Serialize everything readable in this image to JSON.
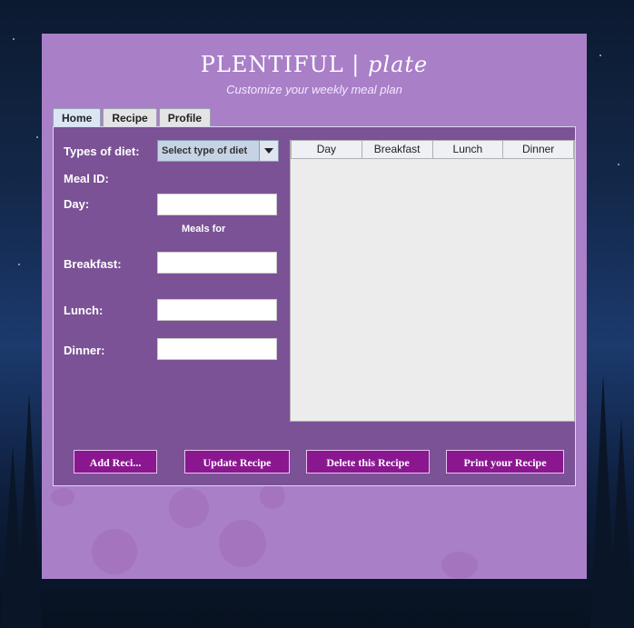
{
  "app": {
    "title_main": "PLENTIFUL |",
    "title_script": "plate",
    "subtitle": "Customize your weekly meal plan"
  },
  "tabs": [
    {
      "label": "Home",
      "active": true
    },
    {
      "label": "Recipe",
      "active": false
    },
    {
      "label": "Profile",
      "active": false
    }
  ],
  "form": {
    "diet_label": "Types of diet:",
    "diet_select": "Select type of diet",
    "meal_id_label": "Meal ID:",
    "day_label": "Day:",
    "day_value": "",
    "meals_for_label": "Meals for",
    "breakfast_label": "Breakfast:",
    "breakfast_value": "",
    "lunch_label": "Lunch:",
    "lunch_value": "",
    "dinner_label": "Dinner:",
    "dinner_value": ""
  },
  "table": {
    "columns": [
      "Day",
      "Breakfast",
      "Lunch",
      "Dinner"
    ],
    "rows": []
  },
  "buttons": {
    "add": "Add Reci...",
    "update": "Update Recipe",
    "delete": "Delete this Recipe",
    "print": "Print your Recipe"
  },
  "colors": {
    "frame_bg": "#a97fc8",
    "panel_bg": "#7b5296",
    "button_bg": "#8a1790"
  }
}
